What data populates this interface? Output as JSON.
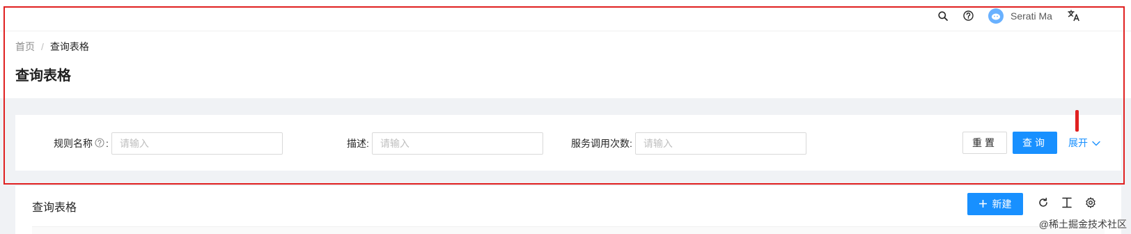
{
  "header": {
    "user_name": "Serati Ma"
  },
  "breadcrumb": {
    "home": "首页",
    "separator": "/",
    "current": "查询表格"
  },
  "page": {
    "title": "查询表格"
  },
  "search_form": {
    "fields": [
      {
        "label": "规则名称",
        "has_help_icon": true,
        "placeholder": "请输入",
        "value": ""
      },
      {
        "label": "描述:",
        "placeholder": "请输入",
        "value": ""
      },
      {
        "label": "服务调用次数:",
        "placeholder": "请输入",
        "value": ""
      }
    ],
    "help_suffix": ":",
    "reset_label": "重置",
    "query_label": "查询",
    "expand_label": "展开"
  },
  "table": {
    "title": "查询表格",
    "new_label": "新建"
  },
  "watermark": "@稀土掘金技术社区",
  "colors": {
    "primary": "#1890ff",
    "annotation_red": "#e02020",
    "background": "#f0f2f5"
  },
  "icons": {
    "header": [
      "search-icon",
      "question-circle-icon",
      "avatar",
      "translation-icon"
    ],
    "toolbar": [
      "reload-icon",
      "column-height-icon",
      "setting-icon"
    ],
    "expand": "chevron-down-icon",
    "new": "plus-icon"
  }
}
